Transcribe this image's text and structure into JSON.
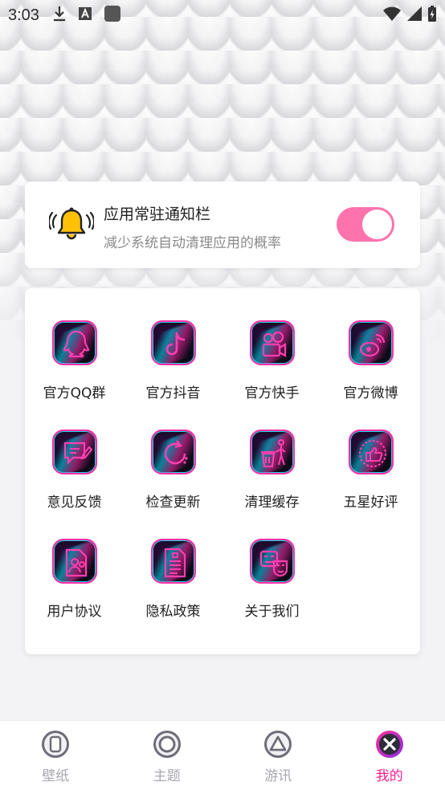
{
  "status_bar": {
    "time": "3:03",
    "icons": [
      "download-icon",
      "text-a-icon",
      "square-app-icon",
      "wifi-icon",
      "signal-icon",
      "battery-charging-icon"
    ]
  },
  "notification_card": {
    "title": "应用常驻通知栏",
    "subtitle": "减少系统自动清理应用的概率",
    "toggle_on": true,
    "icon": "bell-icon",
    "colors": {
      "toggle": "#ff73ad",
      "bell": "#ffc107"
    }
  },
  "grid": {
    "items": [
      {
        "label": "官方QQ群",
        "icon": "qq-penguin-icon"
      },
      {
        "label": "官方抖音",
        "icon": "tiktok-icon"
      },
      {
        "label": "官方快手",
        "icon": "kuaishou-camera-icon"
      },
      {
        "label": "官方微博",
        "icon": "weibo-icon"
      },
      {
        "label": "意见反馈",
        "icon": "feedback-edit-icon"
      },
      {
        "label": "检查更新",
        "icon": "refresh-update-icon"
      },
      {
        "label": "清理缓存",
        "icon": "trash-clean-icon"
      },
      {
        "label": "五星好评",
        "icon": "thumbs-up-icon"
      },
      {
        "label": "用户协议",
        "icon": "user-agreement-icon"
      },
      {
        "label": "隐私政策",
        "icon": "privacy-document-icon"
      },
      {
        "label": "关于我们",
        "icon": "about-masks-icon"
      }
    ]
  },
  "bottom_nav": {
    "items": [
      {
        "label": "壁纸",
        "icon": "wallpaper-tab-icon",
        "active": false
      },
      {
        "label": "主题",
        "icon": "theme-tab-icon",
        "active": false
      },
      {
        "label": "游讯",
        "icon": "game-news-tab-icon",
        "active": false
      },
      {
        "label": "我的",
        "icon": "mine-tab-icon",
        "active": true
      }
    ],
    "colors": {
      "active": "#ff1f8f",
      "inactive": "#a7a7b2"
    }
  }
}
